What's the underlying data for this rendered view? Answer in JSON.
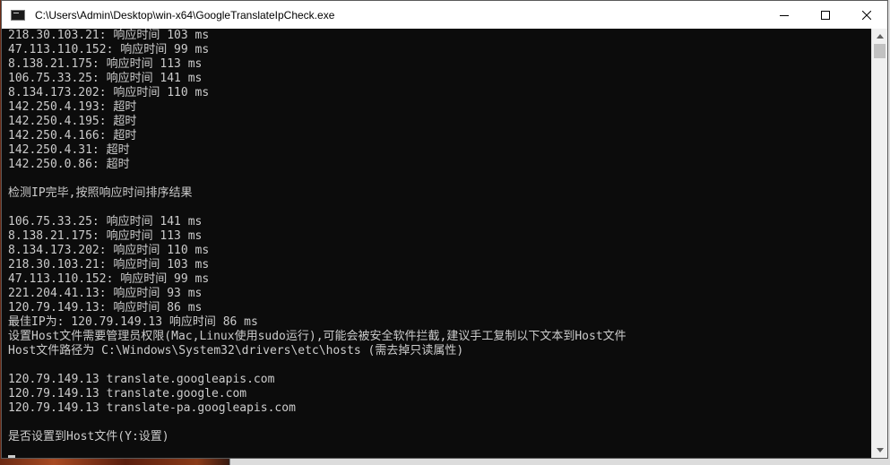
{
  "window": {
    "title": "C:\\Users\\Admin\\Desktop\\win-x64\\GoogleTranslateIpCheck.exe"
  },
  "console": {
    "lines": [
      "218.30.103.21: 响应时间 103 ms",
      "47.113.110.152: 响应时间 99 ms",
      "8.138.21.175: 响应时间 113 ms",
      "106.75.33.25: 响应时间 141 ms",
      "8.134.173.202: 响应时间 110 ms",
      "142.250.4.193: 超时",
      "142.250.4.195: 超时",
      "142.250.4.166: 超时",
      "142.250.4.31: 超时",
      "142.250.0.86: 超时",
      "",
      "检测IP完毕,按照响应时间排序结果",
      "",
      "106.75.33.25: 响应时间 141 ms",
      "8.138.21.175: 响应时间 113 ms",
      "8.134.173.202: 响应时间 110 ms",
      "218.30.103.21: 响应时间 103 ms",
      "47.113.110.152: 响应时间 99 ms",
      "221.204.41.13: 响应时间 93 ms",
      "120.79.149.13: 响应时间 86 ms",
      "最佳IP为: 120.79.149.13 响应时间 86 ms",
      "设置Host文件需要管理员权限(Mac,Linux使用sudo运行),可能会被安全软件拦截,建议手工复制以下文本到Host文件",
      "Host文件路径为 C:\\Windows\\System32\\drivers\\etc\\hosts (需去掉只读属性)",
      "",
      "120.79.149.13 translate.googleapis.com",
      "120.79.149.13 translate.google.com",
      "120.79.149.13 translate-pa.googleapis.com",
      "",
      "是否设置到Host文件(Y:设置)"
    ]
  },
  "icons": {
    "app": "console-app-icon",
    "minimize": "minimize-icon",
    "maximize": "maximize-icon",
    "close": "close-icon"
  },
  "colors": {
    "console_bg": "#0c0c0c",
    "console_fg": "#cccccc",
    "titlebar_bg": "#ffffff"
  }
}
